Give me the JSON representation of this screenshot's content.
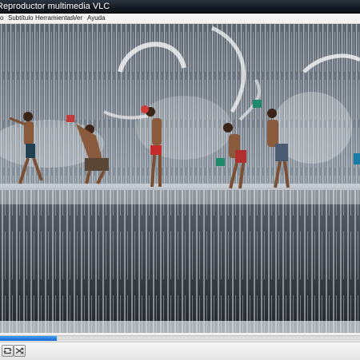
{
  "window": {
    "title": "Reproductor multimedia VLC"
  },
  "menu": {
    "items": [
      {
        "label": "o"
      },
      {
        "label": "Subtítulo"
      },
      {
        "label": "Herramientas"
      },
      {
        "label": "Ver"
      },
      {
        "label": "Ayuda"
      }
    ]
  },
  "playback": {
    "progress": 0.157
  },
  "controls": {
    "loop_icon": "loop-icon",
    "shuffle_icon": "shuffle-icon"
  },
  "colors": {
    "seek_fill": "#1a6fd6",
    "titlebar": "#141a22"
  }
}
